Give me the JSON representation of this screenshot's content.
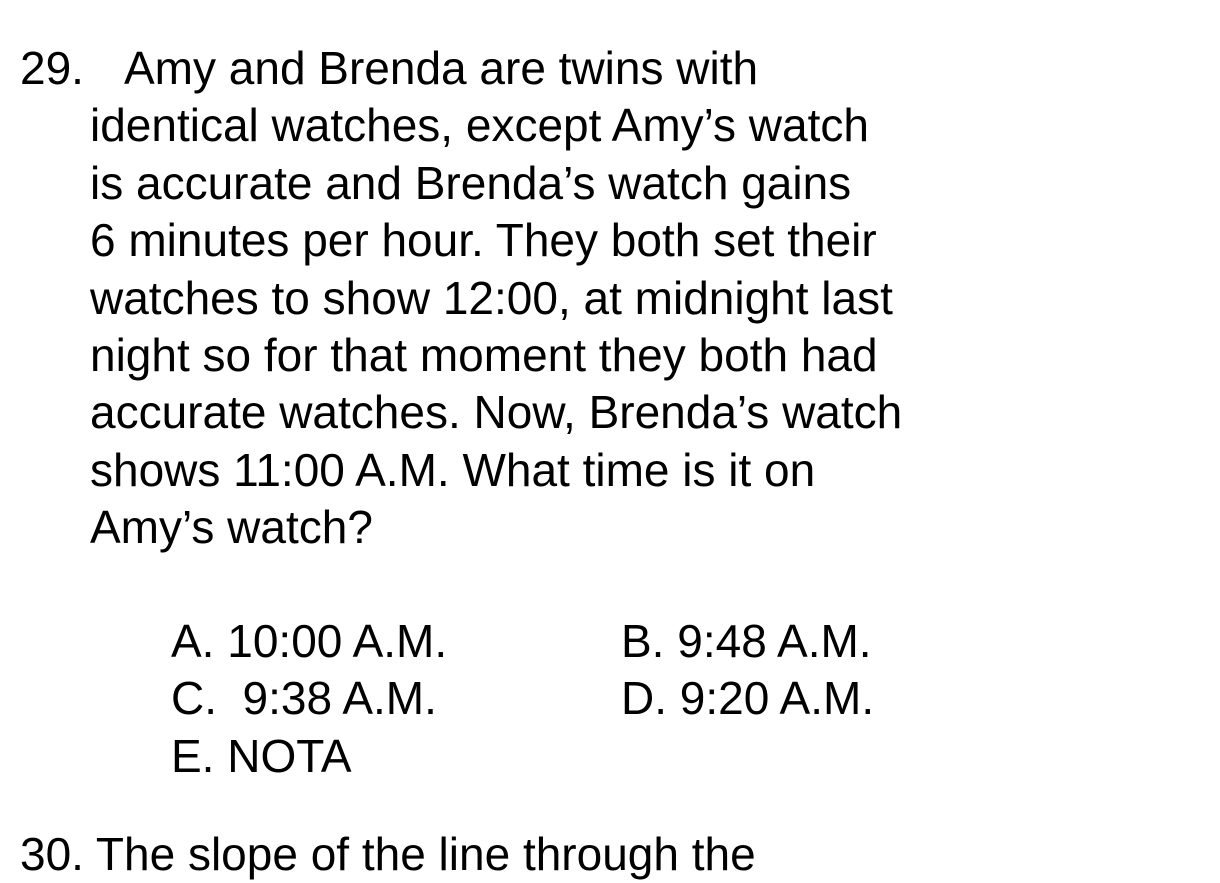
{
  "question": {
    "number": "29.",
    "lines": [
      "Amy and Brenda are twins with",
      "identical watches, except Amy’s watch",
      "is accurate and Brenda’s watch gains",
      "6 minutes per hour. They both set their",
      "watches to show 12:00, at midnight last",
      "night so for that moment they both had",
      "accurate watches. Now, Brenda’s watch",
      "shows 11:00 A.M.  What time is it on",
      "Amy’s watch?"
    ],
    "choices": {
      "a": "A. 10:00 A.M.",
      "b": "B. 9:48 A.M.",
      "c": "C.  9:38 A.M.",
      "d": "D. 9:20 A.M.",
      "e": "E. NOTA"
    }
  },
  "next_question": {
    "partial_text": "30.  The slope of the line through the"
  }
}
